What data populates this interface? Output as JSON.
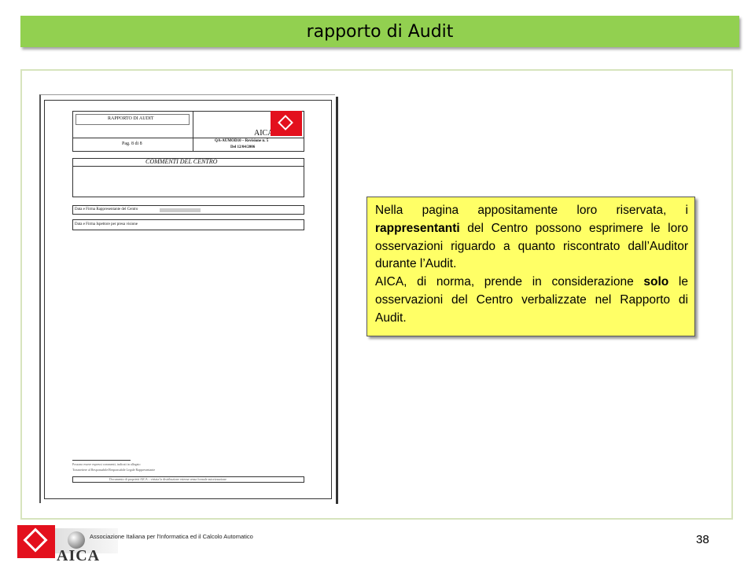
{
  "header": {
    "title": "rapporto di Audit"
  },
  "document_preview": {
    "title_cell": "RAPPORTO DI AUDIT",
    "brand": "AICA",
    "page_cell": "Pag. 8 di 8",
    "code": "QA-AUMOD10 – Revisione n. 5",
    "date": "Del 12/04/2006",
    "section_title": "COMMENTI DEL CENTRO",
    "row1": "Data e Firma Rappresentante del Centro",
    "row2": "Data e Firma Ispettore per presa visione",
    "footnote1": "Possono essere espressi commenti, indicati in allegato",
    "footnote2": "Trasmettere al Responsabile/Responsabile Legale Rappresentante",
    "footer_text": "Documento di proprietà AICA – vietata la distribuzione esterna senza formale autorizzazione"
  },
  "callout": {
    "p1_a": "Nella pagina appositamente loro riservata, i ",
    "p1_bold": "rappresentanti",
    "p1_b": " del Centro possono esprimere le loro osservazioni riguardo a quanto riscontrato dall’Auditor durante l’Audit.",
    "p2_a": "AICA, di norma, prende in considerazione ",
    "p2_bold": "solo",
    "p2_b": " le osservazioni del Centro verbalizzate nel Rapporto di Audit."
  },
  "footer": {
    "association": "Associazione Italiana per l'Informatica ed il Calcolo Automatico",
    "brand": "AICA",
    "page_number": "38"
  },
  "colors": {
    "title_bar": "#92d050",
    "frame": "#d7e4bd",
    "callout": "#ffff66",
    "brand_red": "#e3101d"
  }
}
